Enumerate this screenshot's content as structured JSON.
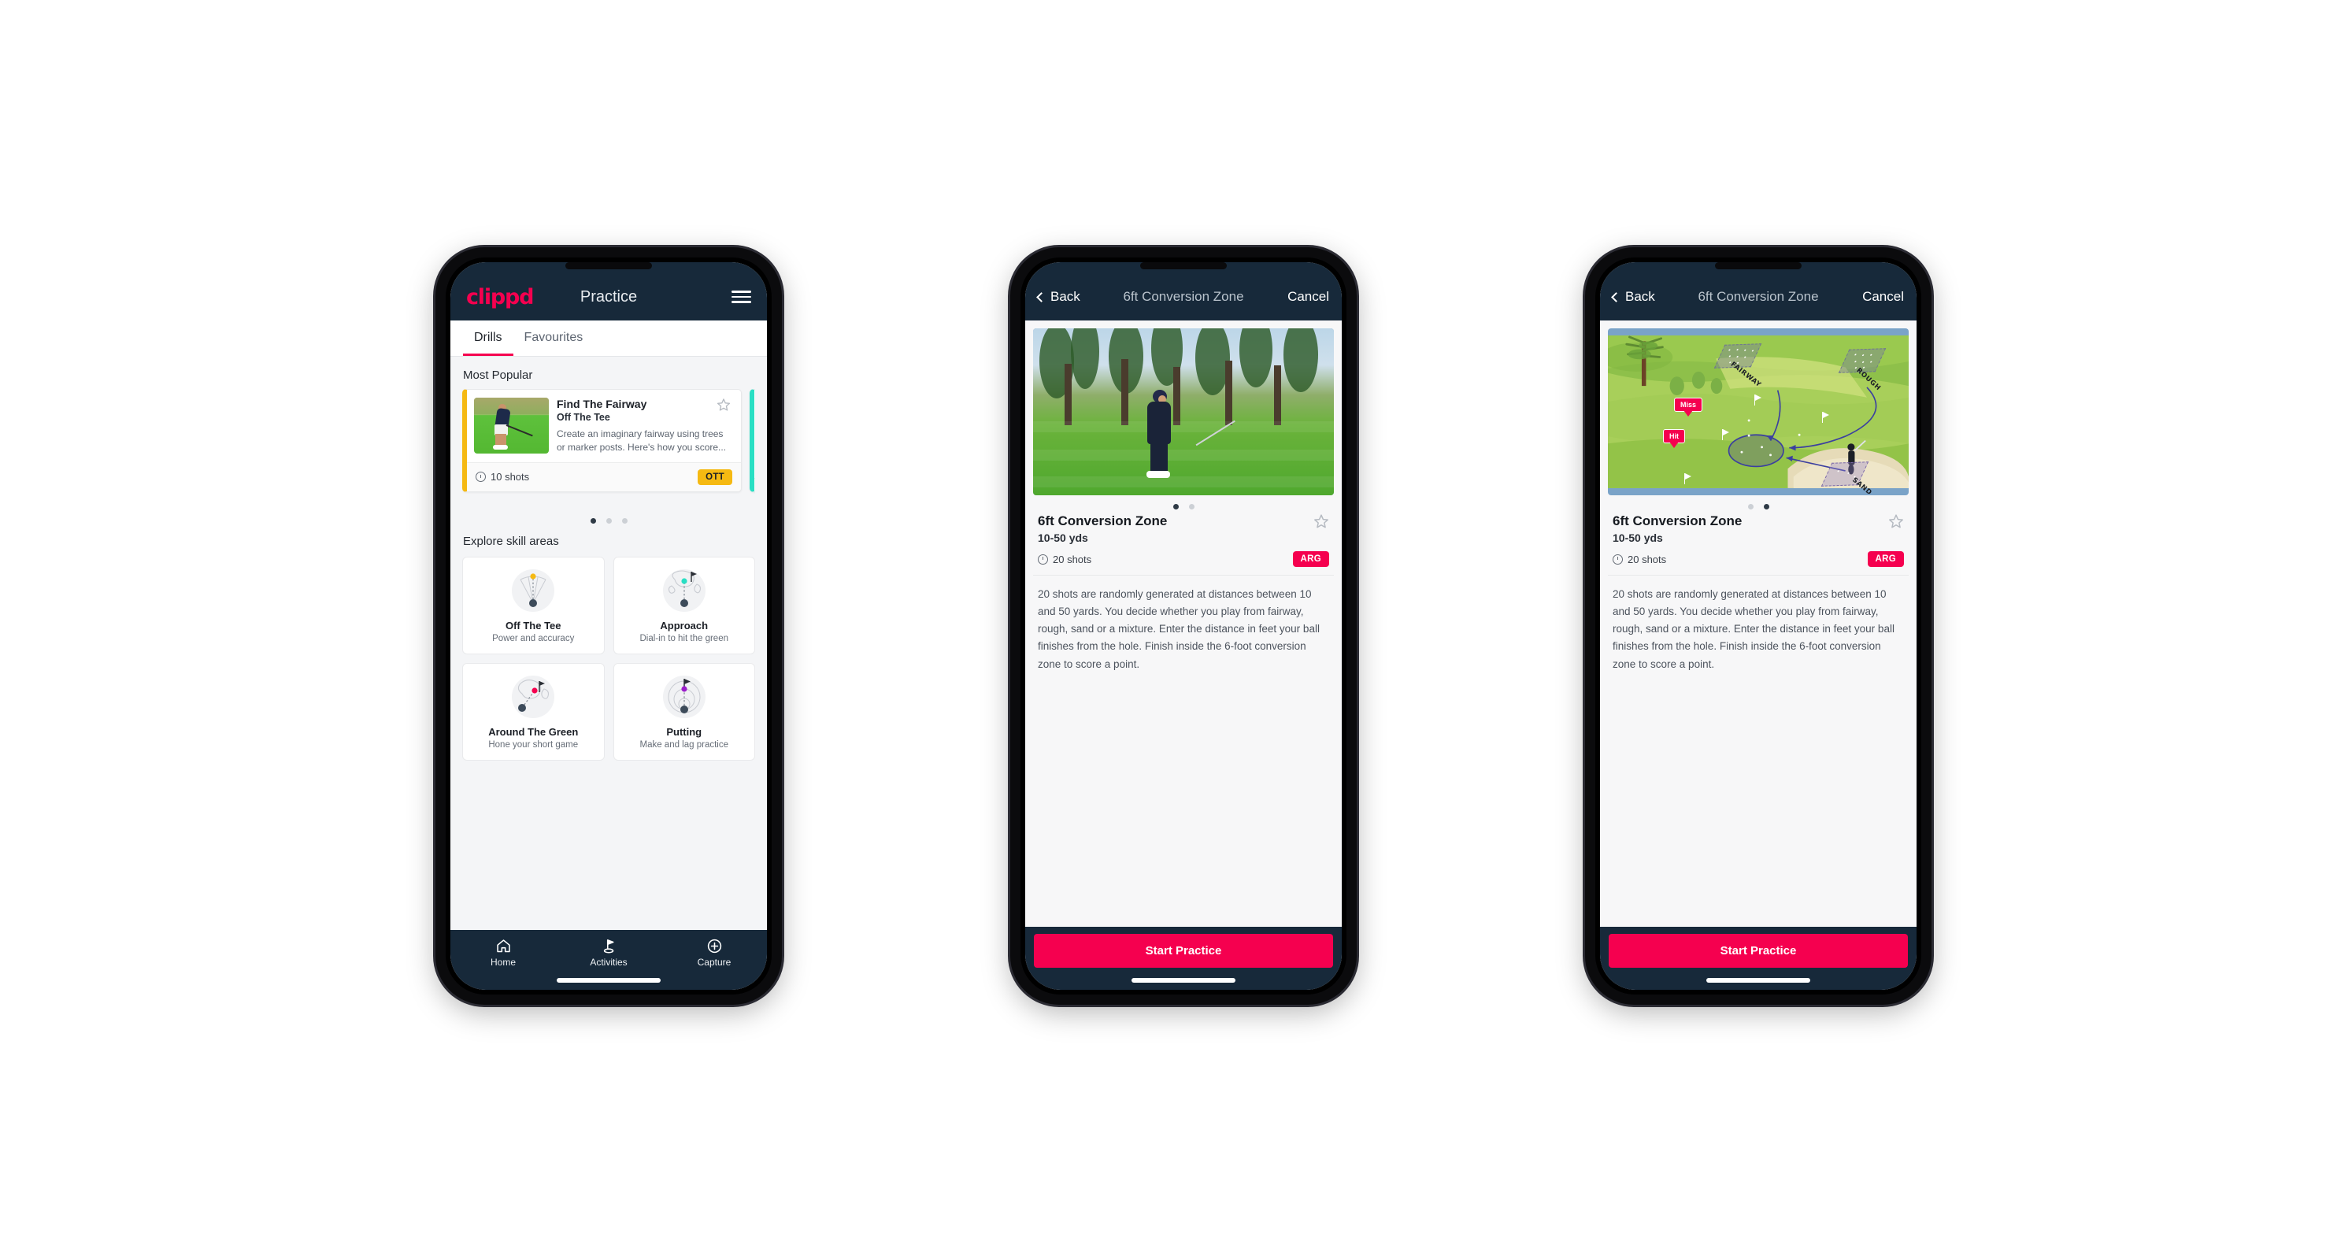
{
  "app": {
    "brand": "clippd",
    "accent_pink": "#f5004f",
    "header_navy": "#17293a",
    "badge_yellow": "#f5b912",
    "badge_teal": "#29dfc4"
  },
  "practice_screen": {
    "header": {
      "title": "Practice",
      "menu_icon": "hamburger-menu-icon"
    },
    "tabs": [
      {
        "label": "Drills",
        "active": true
      },
      {
        "label": "Favourites",
        "active": false
      }
    ],
    "most_popular": {
      "section_title": "Most Popular",
      "cards": [
        {
          "title": "Find The Fairway",
          "subtitle": "Off The Tee",
          "description": "Create an imaginary fairway using trees or marker posts. Here's how you score...",
          "shots": "10 shots",
          "badge": "OTT",
          "accent": "#f5b912",
          "favourite": false
        },
        {
          "title": "",
          "subtitle": "",
          "description": "",
          "shots": "",
          "badge": "",
          "accent": "#29dfc4",
          "favourite": false
        }
      ],
      "dots": {
        "count": 3,
        "active_index": 0
      }
    },
    "skill_areas": {
      "section_title": "Explore skill areas",
      "items": [
        {
          "name": "Off The Tee",
          "desc": "Power and accuracy",
          "icon": "tee-fan-icon",
          "dot_color": "#f5b912"
        },
        {
          "name": "Approach",
          "desc": "Dial-in to hit the green",
          "icon": "approach-green-icon",
          "dot_color": "#29dfc4"
        },
        {
          "name": "Around The Green",
          "desc": "Hone your short game",
          "icon": "chip-green-icon",
          "dot_color": "#f5004f"
        },
        {
          "name": "Putting",
          "desc": "Make and lag practice",
          "icon": "putting-rings-icon",
          "dot_color": "#9b1ecb"
        }
      ]
    },
    "bottom_nav": [
      {
        "label": "Home",
        "icon": "home-icon",
        "active": false
      },
      {
        "label": "Activities",
        "icon": "golf-flag-icon",
        "active": true
      },
      {
        "label": "Capture",
        "icon": "plus-circle-icon",
        "active": false
      }
    ]
  },
  "detail_screen": {
    "header": {
      "back_label": "Back",
      "title": "6ft Conversion Zone",
      "cancel_label": "Cancel"
    },
    "title": "6ft Conversion Zone",
    "distance": "10-50 yds",
    "shots": "20 shots",
    "badge": "ARG",
    "description": "20 shots are randomly generated at distances between 10 and 50 yards. You decide whether you play from fairway, rough, sand or a mixture. Enter the distance in feet your ball finishes from the hole. Finish inside the 6-foot conversion zone to score a point.",
    "cta_label": "Start Practice",
    "media_photo": {
      "dots": {
        "count": 2,
        "active_index": 0
      },
      "alt": "golfer-chipping-photo"
    },
    "media_diagram": {
      "dots": {
        "count": 2,
        "active_index": 1
      },
      "alt": "course-zones-diagram",
      "zone_labels": [
        "FAIRWAY",
        "ROUGH",
        "SAND"
      ],
      "markers": [
        "Miss",
        "Hit"
      ]
    }
  }
}
